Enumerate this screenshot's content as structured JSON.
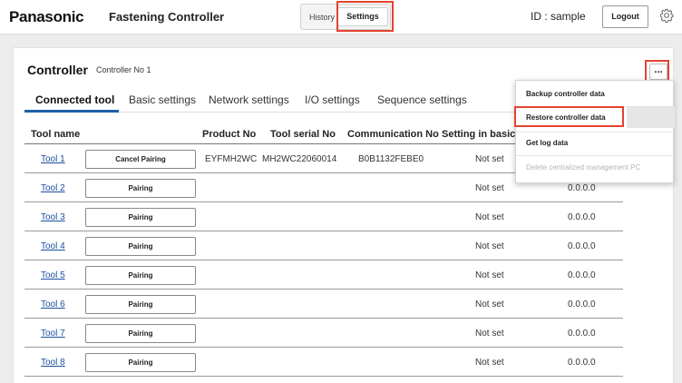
{
  "header": {
    "brand": "Panasonic",
    "app_title": "Fastening Controller",
    "nav": {
      "history_label": "History",
      "settings_label": "Settings"
    },
    "user_id": "ID : sample",
    "logout_label": "Logout",
    "settings_icon": "gear-icon"
  },
  "controller": {
    "title": "Controller",
    "subtitle": "Controller No 1",
    "more_label": "...",
    "tabs": [
      {
        "label": "Connected tool",
        "active": true
      },
      {
        "label": "Basic settings",
        "active": false
      },
      {
        "label": "Network settings",
        "active": false
      },
      {
        "label": "I/O settings",
        "active": false
      },
      {
        "label": "Sequence settings",
        "active": false
      }
    ]
  },
  "table": {
    "columns": [
      "Tool name",
      "Product No",
      "Tool serial No",
      "Communication No",
      "Setting in basic m"
    ],
    "rows": [
      {
        "tool": "Tool 1",
        "action": "Cancel Pairing",
        "product_no": "EYFMH2WC",
        "serial_no": "MH2WC22060014",
        "comm_no": "B0B1132FEBE0",
        "basic": "Not set",
        "ip": ""
      },
      {
        "tool": "Tool 2",
        "action": "Pairing",
        "product_no": "",
        "serial_no": "",
        "comm_no": "",
        "basic": "Not set",
        "ip": "0.0.0.0"
      },
      {
        "tool": "Tool 3",
        "action": "Pairing",
        "product_no": "",
        "serial_no": "",
        "comm_no": "",
        "basic": "Not set",
        "ip": "0.0.0.0"
      },
      {
        "tool": "Tool 4",
        "action": "Pairing",
        "product_no": "",
        "serial_no": "",
        "comm_no": "",
        "basic": "Not set",
        "ip": "0.0.0.0"
      },
      {
        "tool": "Tool 5",
        "action": "Pairing",
        "product_no": "",
        "serial_no": "",
        "comm_no": "",
        "basic": "Not set",
        "ip": "0.0.0.0"
      },
      {
        "tool": "Tool 6",
        "action": "Pairing",
        "product_no": "",
        "serial_no": "",
        "comm_no": "",
        "basic": "Not set",
        "ip": "0.0.0.0"
      },
      {
        "tool": "Tool 7",
        "action": "Pairing",
        "product_no": "",
        "serial_no": "",
        "comm_no": "",
        "basic": "Not set",
        "ip": "0.0.0.0"
      },
      {
        "tool": "Tool 8",
        "action": "Pairing",
        "product_no": "",
        "serial_no": "",
        "comm_no": "",
        "basic": "Not set",
        "ip": "0.0.0.0"
      }
    ]
  },
  "menu": {
    "items": [
      {
        "label": "Backup controller data",
        "enabled": true
      },
      {
        "label": "Restore controller data",
        "enabled": true
      },
      {
        "label": "Get log data",
        "enabled": true
      },
      {
        "label": "Delete centralized management PC",
        "enabled": false
      }
    ]
  },
  "colors": {
    "highlight": "#e4432e",
    "tab_accent": "#1e5fa8",
    "link": "#1a4fa0"
  }
}
